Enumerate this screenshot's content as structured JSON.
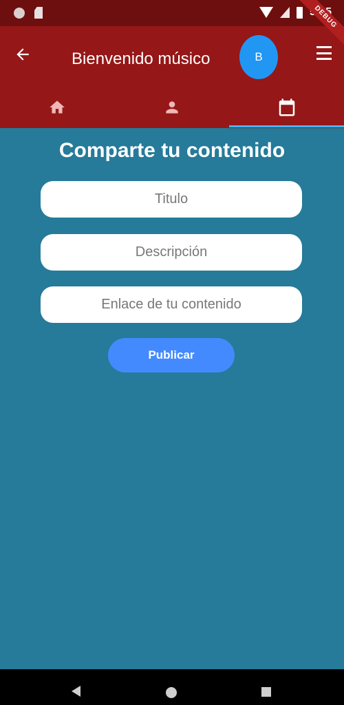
{
  "status_bar": {
    "time": "5:45",
    "icons": [
      "notification-dot-icon",
      "sd-card-icon",
      "wifi-icon",
      "signal-icon",
      "battery-icon"
    ]
  },
  "debug_banner": "DEBUG",
  "app_bar": {
    "title": "Bienvenido músico",
    "avatar_initial": "B",
    "back_icon": "arrow-back-icon",
    "menu_icon": "hamburger-menu-icon"
  },
  "tabs": [
    {
      "icon": "home-icon",
      "selected": false
    },
    {
      "icon": "person-icon",
      "selected": false
    },
    {
      "icon": "calendar-icon",
      "selected": true
    }
  ],
  "form": {
    "heading": "Comparte tu contenido",
    "title_placeholder": "Titulo",
    "description_placeholder": "Descripción",
    "link_placeholder": "Enlace de tu contenido",
    "submit_label": "Publicar"
  },
  "colors": {
    "status_bar": "#6e0f0f",
    "app_bar": "#951717",
    "background": "#257b99",
    "avatar": "#2196f3",
    "button": "#448aff",
    "tab_indicator": "#4fb0ff"
  }
}
